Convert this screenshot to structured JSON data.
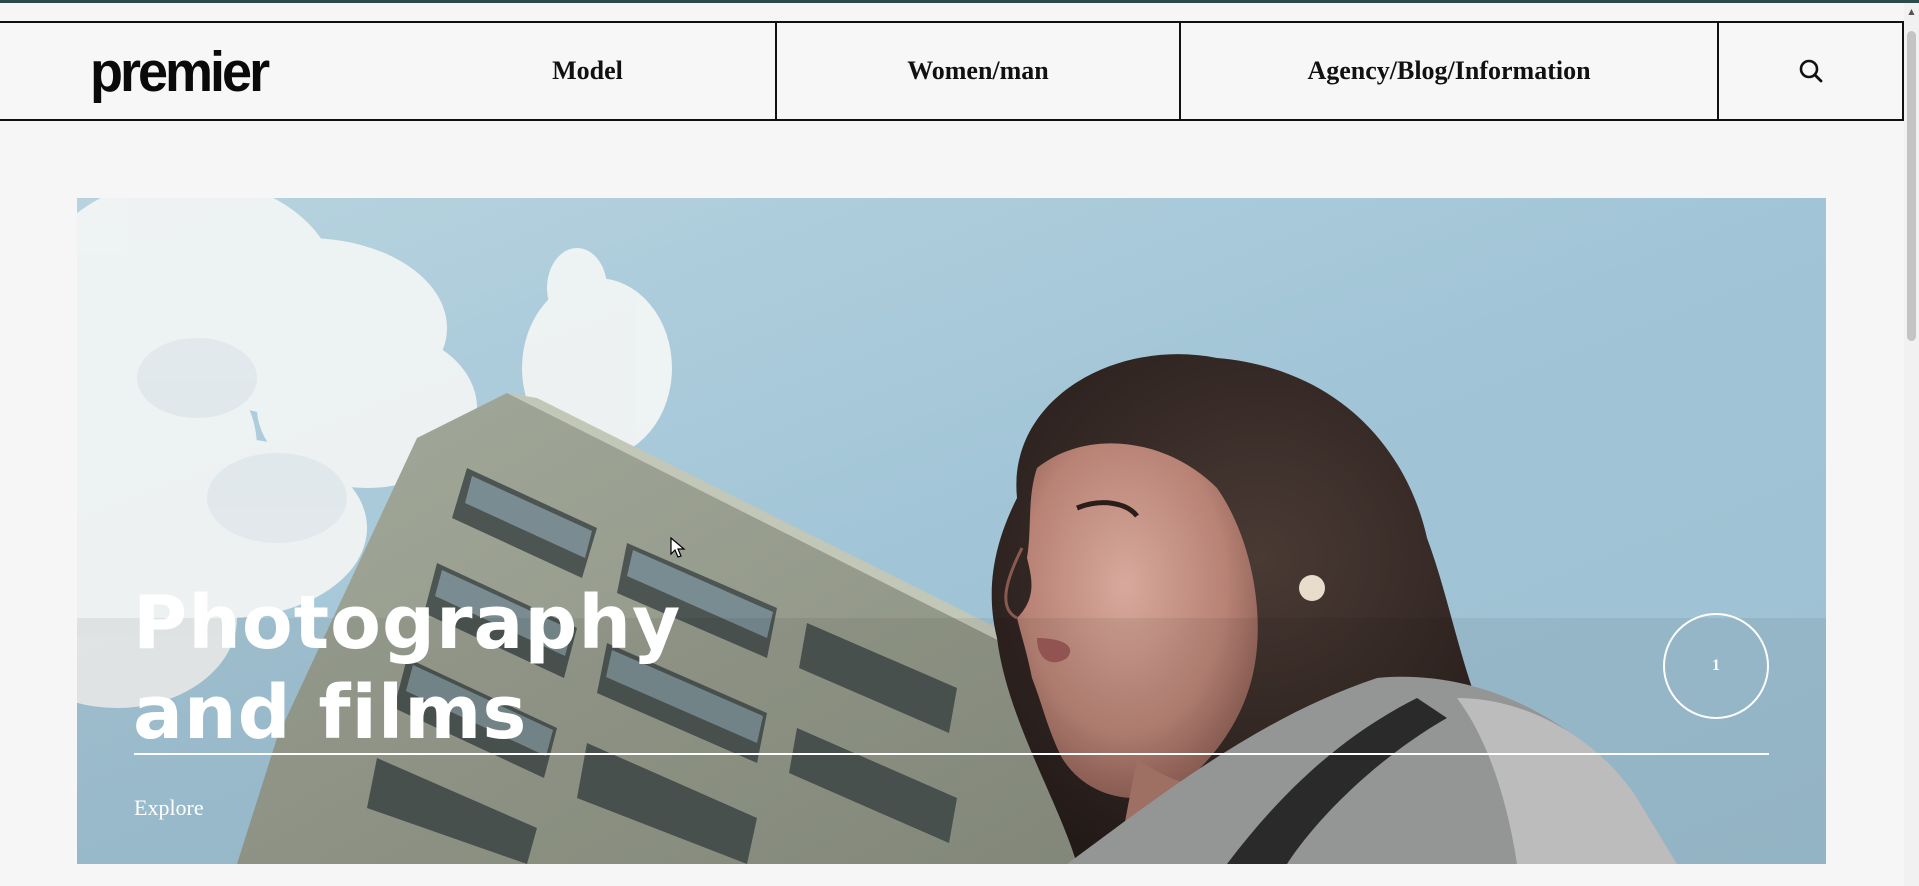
{
  "header": {
    "logo_text": "premier",
    "nav": [
      {
        "label": "Model"
      },
      {
        "label": "Women/man"
      },
      {
        "label": "Agency/Blog/Information"
      }
    ],
    "search_icon": "search-icon"
  },
  "hero": {
    "title_line1": "Photography",
    "title_line2": "and films",
    "slide_number": "1",
    "cta_label": "Explore"
  },
  "colors": {
    "nav_border": "#111111",
    "page_background": "#f6f6f6",
    "hero_text": "#ffffff",
    "sky": "#a4c6d6"
  }
}
